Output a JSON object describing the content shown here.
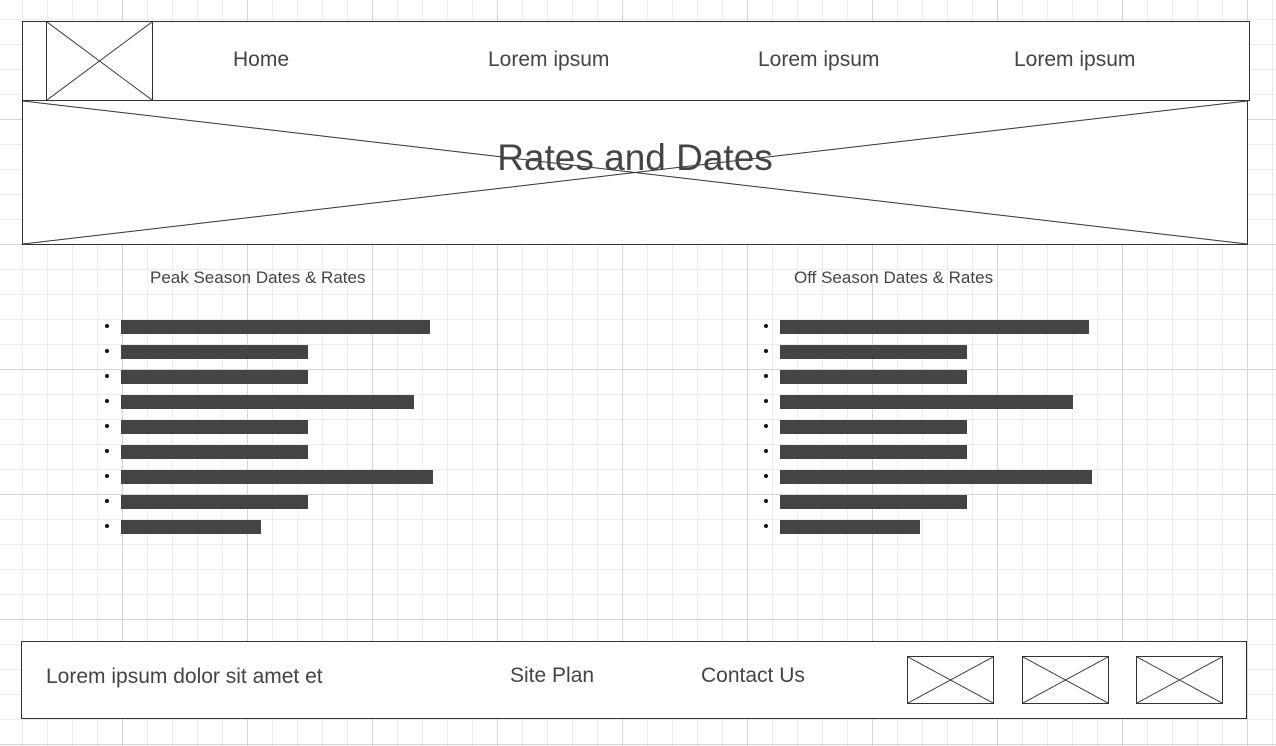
{
  "nav": {
    "logo_icon": "image-placeholder-icon",
    "links": [
      "Home",
      "Lorem ipsum",
      "Lorem ipsum",
      "Lorem ipsum"
    ]
  },
  "hero": {
    "title": "Rates and Dates",
    "image_icon": "image-placeholder-icon"
  },
  "peak": {
    "title": "Peak Season Dates & Rates",
    "item_fill": [
      0.99,
      0.6,
      0.6,
      0.94,
      0.6,
      0.6,
      1.0,
      0.6,
      0.45
    ]
  },
  "off": {
    "title": "Off Season Dates & Rates",
    "item_fill": [
      0.99,
      0.6,
      0.6,
      0.94,
      0.6,
      0.6,
      1.0,
      0.6,
      0.45
    ]
  },
  "footer": {
    "text": "Lorem ipsum dolor sit amet et",
    "site_plan": "Site Plan",
    "contact": "Contact Us",
    "icons": [
      "image-placeholder-icon",
      "image-placeholder-icon",
      "image-placeholder-icon"
    ]
  },
  "colors": {
    "text": "#444444",
    "border": "#333333",
    "bar": "#444444",
    "grid_major": "#d4d4d4",
    "grid_minor": "#ececec"
  }
}
